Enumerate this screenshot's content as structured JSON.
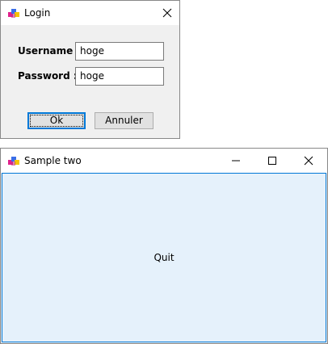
{
  "login_window": {
    "title": "Login",
    "icon": "app-icon",
    "username_label": "Username :",
    "password_label": "Password :",
    "username_value": "hoge",
    "password_value": "hoge",
    "ok_label": "Ok",
    "cancel_label": "Annuler"
  },
  "sample_window": {
    "title": "Sample two",
    "icon": "app-icon",
    "quit_label": "Quit"
  },
  "colors": {
    "accent": "#0078d7",
    "client_background": "#e5f1fb",
    "dialog_background": "#f0f0f0"
  }
}
